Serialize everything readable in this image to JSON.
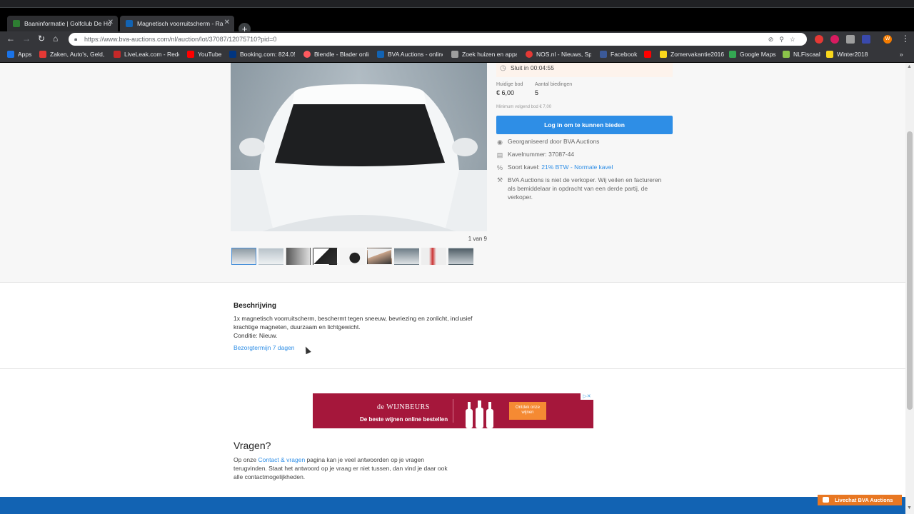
{
  "browser": {
    "tabs": [
      {
        "title": "Baaninformatie | Golfclub De Ho",
        "active": false
      },
      {
        "title": "Magnetisch voorruitscherm - Ra",
        "active": true
      }
    ],
    "url": "https://www.bva-auctions.com/nl/auction/lot/37087/12075710?pid=0",
    "bookmarks": [
      "Apps",
      "Zaken, Auto's, Geld, ...",
      "LiveLeak.com - Rede...",
      "YouTube",
      "Booking.com: 824.05...",
      "Blendle - Blader onlin...",
      "BVA Auctions - online...",
      "Zoek huizen en appa...",
      "NOS.nl - Nieuws, Spo...",
      "Facebook",
      "Zomervakantie2016",
      "Google Maps",
      "NLFiscaal",
      "Winter2018"
    ],
    "profile_initial": "W"
  },
  "lot": {
    "closes": "Sluit in 00:04:55",
    "current_bid_label": "Huidige bod",
    "current_bid": "€  6,00",
    "bids_label": "Aantal biedingen",
    "bids": "5",
    "min_next_bid": "Minimum volgend bod €  7,00",
    "login_button": "Log in om te kunnen bieden",
    "organised_by": "Georganiseerd door BVA Auctions",
    "lot_number": "Kavelnummer: 37087-44",
    "lot_type_label": "Soort kavel:",
    "lot_type_link": "21% BTW - Normale kavel",
    "disclaimer": "BVA Auctions is niet de verkoper. Wij veilen en factureren als bemiddelaar in opdracht van een derde partij, de verkoper.",
    "image_counter": "1 van 9"
  },
  "description": {
    "title": "Beschrijving",
    "text": "1x magnetisch voorruitscherm, beschermt tegen sneeuw, bevriezing en zonlicht, inclusief krachtige magneten, duurzaam en lichtgewicht.",
    "condition": "Conditie: Nieuw.",
    "delivery_link": "Bezorgtermijn 7 dagen"
  },
  "ad": {
    "logo": "de WIJNBEURS",
    "tagline": "De beste wijnen online bestellen",
    "button": "Ontdek onze wijnen"
  },
  "questions": {
    "title": "Vragen?",
    "text_before": "Op onze ",
    "link": "Contact & vragen",
    "text_after": " pagina kan je veel antwoorden op je vragen terugvinden. Staat het antwoord op je vraag er niet tussen, dan vind je daar ook alle contactmogelijkheden."
  },
  "livechat": "Livechat BVA Auctions"
}
